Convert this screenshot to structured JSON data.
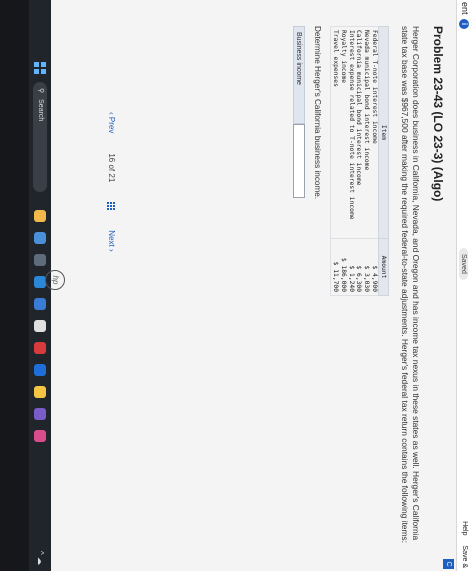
{
  "topbar": {
    "left_text": "ent",
    "saved": "Saved",
    "help": "Help",
    "save_exit": "Save &"
  },
  "problem": {
    "title": "Problem 23-43 (LO 23-3) (Algo)",
    "description": "Herger Corporation does business in California, Nevada, and Oregon and has income tax nexus in these states as well. Herger's California state tax base was $967,500 after making the required federal-to-state adjustments. Herger's federal tax return contains the following items:"
  },
  "table": {
    "header_item": "Item",
    "header_amount": "Amount",
    "rows": [
      {
        "item": "Federal T-note interest income",
        "amount": "$ 4,900"
      },
      {
        "item": "Nevada municipal bond interest income",
        "amount": "$ 3,030"
      },
      {
        "item": "California municipal bond interest income",
        "amount": "$ 6,300"
      },
      {
        "item": "Interest expense related to T-note interest income",
        "amount": "$ 1,240"
      },
      {
        "item": "Royalty income",
        "amount": "$ 186,000"
      },
      {
        "item": "Travel expenses",
        "amount": "$ 11,700"
      }
    ]
  },
  "question": "Determine Herger's California business income.",
  "answer": {
    "label": "Business income",
    "value": ""
  },
  "pager": {
    "prev": "Prev",
    "current": "16",
    "of": "of",
    "total": "21",
    "next": "Next"
  },
  "taskbar": {
    "search_placeholder": "Search"
  },
  "colors": {
    "accent": "#1f5fbf",
    "table_header": "#e2e7ee"
  }
}
